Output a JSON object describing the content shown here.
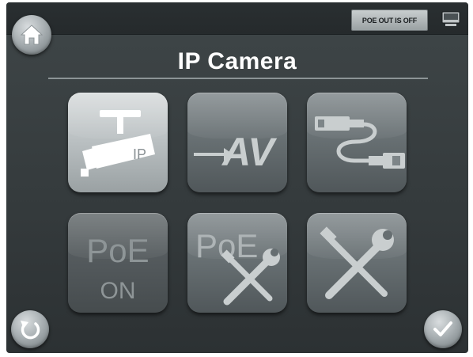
{
  "header": {
    "poe_status": "POE OUT IS OFF"
  },
  "page": {
    "title": "IP Camera"
  },
  "tiles": [
    {
      "label": "IP",
      "icon": "ip-camera-icon",
      "state": "selected"
    },
    {
      "label": "AV",
      "icon": "av-icon",
      "state": "normal"
    },
    {
      "label": "",
      "icon": "cable-icon",
      "state": "normal"
    },
    {
      "label": "PoE",
      "sublabel": "ON",
      "icon": "poe-on-icon",
      "state": "dimmed"
    },
    {
      "label": "PoE",
      "icon": "poe-tools-icon",
      "state": "normal"
    },
    {
      "label": "",
      "icon": "tools-icon",
      "state": "normal"
    }
  ],
  "colors": {
    "background": "#3a4143",
    "tile": "#6a7275",
    "tile_selected": "#c4c9cb",
    "title_text": "#ffffff"
  }
}
